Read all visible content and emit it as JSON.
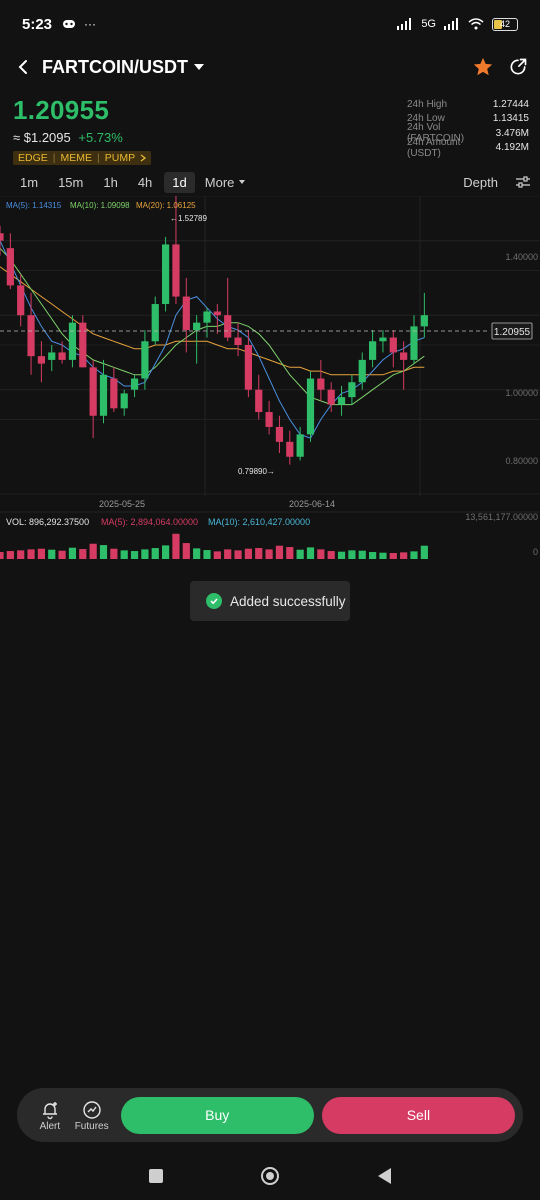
{
  "status_bar": {
    "time": "5:23",
    "network": "5G",
    "battery": "42"
  },
  "header": {
    "pair": "FARTCOIN/USDT"
  },
  "price": {
    "last": "1.20955",
    "fiat": "≈ $1.2095",
    "change": "+5.73%"
  },
  "tags": [
    "EDGE",
    "MEME",
    "PUMP"
  ],
  "stats": [
    {
      "label": "24h High",
      "value": "1.27444"
    },
    {
      "label": "24h Low",
      "value": "1.13415"
    },
    {
      "label": "24h Vol (FARTCOIN)",
      "value": "3.476M"
    },
    {
      "label": "24h Amount (USDT)",
      "value": "4.192M"
    }
  ],
  "intervals": {
    "items": [
      "1m",
      "15m",
      "1h",
      "4h",
      "1d"
    ],
    "active": "1d",
    "more": "More",
    "depth": "Depth"
  },
  "colors": {
    "up": "#2ebd68",
    "down": "#d63c63",
    "ma5": "#4a90e2",
    "ma10": "#7ed36b",
    "ma20": "#e8a43c"
  },
  "chart_data": {
    "type": "candlestick",
    "ma_legend": {
      "ma5": "MA(5): 1.14315",
      "ma10": "MA(10): 1.09098",
      "ma20": "MA(20): 1.06125"
    },
    "price_axis": [
      {
        "value": 1.4,
        "label": "1.40000"
      },
      {
        "value": 1.0,
        "label": "1.00000"
      },
      {
        "value": 0.8,
        "label": "0.80000"
      }
    ],
    "ylim": [
      0.72,
      1.52
    ],
    "current_price": {
      "value": 1.20955,
      "label": "1.20955"
    },
    "max_marker": {
      "value": 1.52789,
      "label": "←1.52789"
    },
    "min_marker": {
      "value": 0.7989,
      "label": "0.79890→"
    },
    "date_labels": [
      "2025-05-25",
      "2025-06-14"
    ],
    "candles": [
      {
        "o": 1.42,
        "h": 1.44,
        "l": 1.36,
        "c": 1.4
      },
      {
        "o": 1.38,
        "h": 1.42,
        "l": 1.27,
        "c": 1.28
      },
      {
        "o": 1.28,
        "h": 1.31,
        "l": 1.17,
        "c": 1.2
      },
      {
        "o": 1.2,
        "h": 1.26,
        "l": 1.04,
        "c": 1.09
      },
      {
        "o": 1.09,
        "h": 1.13,
        "l": 1.02,
        "c": 1.07
      },
      {
        "o": 1.08,
        "h": 1.12,
        "l": 1.05,
        "c": 1.1
      },
      {
        "o": 1.1,
        "h": 1.13,
        "l": 1.07,
        "c": 1.08
      },
      {
        "o": 1.08,
        "h": 1.2,
        "l": 1.06,
        "c": 1.18
      },
      {
        "o": 1.18,
        "h": 1.2,
        "l": 1.06,
        "c": 1.06
      },
      {
        "o": 1.06,
        "h": 1.08,
        "l": 0.87,
        "c": 0.93
      },
      {
        "o": 0.93,
        "h": 1.08,
        "l": 0.91,
        "c": 1.04
      },
      {
        "o": 1.03,
        "h": 1.06,
        "l": 0.94,
        "c": 0.95
      },
      {
        "o": 0.95,
        "h": 1.0,
        "l": 0.93,
        "c": 0.99
      },
      {
        "o": 1.0,
        "h": 1.04,
        "l": 0.98,
        "c": 1.03
      },
      {
        "o": 1.03,
        "h": 1.16,
        "l": 1.0,
        "c": 1.13
      },
      {
        "o": 1.13,
        "h": 1.25,
        "l": 1.12,
        "c": 1.23
      },
      {
        "o": 1.23,
        "h": 1.41,
        "l": 1.21,
        "c": 1.39
      },
      {
        "o": 1.39,
        "h": 1.52789,
        "l": 1.23,
        "c": 1.25
      },
      {
        "o": 1.25,
        "h": 1.3,
        "l": 1.1,
        "c": 1.16
      },
      {
        "o": 1.16,
        "h": 1.2,
        "l": 1.07,
        "c": 1.18
      },
      {
        "o": 1.18,
        "h": 1.22,
        "l": 1.14,
        "c": 1.21
      },
      {
        "o": 1.21,
        "h": 1.23,
        "l": 1.15,
        "c": 1.2
      },
      {
        "o": 1.2,
        "h": 1.3,
        "l": 1.13,
        "c": 1.14
      },
      {
        "o": 1.14,
        "h": 1.18,
        "l": 1.09,
        "c": 1.12
      },
      {
        "o": 1.12,
        "h": 1.16,
        "l": 0.98,
        "c": 1.0
      },
      {
        "o": 1.0,
        "h": 1.04,
        "l": 0.92,
        "c": 0.94
      },
      {
        "o": 0.94,
        "h": 0.97,
        "l": 0.88,
        "c": 0.9
      },
      {
        "o": 0.9,
        "h": 0.93,
        "l": 0.83,
        "c": 0.86
      },
      {
        "o": 0.86,
        "h": 0.89,
        "l": 0.7989,
        "c": 0.82
      },
      {
        "o": 0.82,
        "h": 0.9,
        "l": 0.81,
        "c": 0.88
      },
      {
        "o": 0.88,
        "h": 1.05,
        "l": 0.86,
        "c": 1.03
      },
      {
        "o": 1.03,
        "h": 1.08,
        "l": 0.97,
        "c": 1.0
      },
      {
        "o": 1.0,
        "h": 1.02,
        "l": 0.94,
        "c": 0.96
      },
      {
        "o": 0.96,
        "h": 1.01,
        "l": 0.93,
        "c": 0.98
      },
      {
        "o": 0.98,
        "h": 1.04,
        "l": 0.96,
        "c": 1.02
      },
      {
        "o": 1.02,
        "h": 1.1,
        "l": 1.0,
        "c": 1.08
      },
      {
        "o": 1.08,
        "h": 1.16,
        "l": 1.06,
        "c": 1.13
      },
      {
        "o": 1.13,
        "h": 1.16,
        "l": 1.1,
        "c": 1.14
      },
      {
        "o": 1.14,
        "h": 1.16,
        "l": 1.06,
        "c": 1.1
      },
      {
        "o": 1.1,
        "h": 1.13,
        "l": 1.0,
        "c": 1.08
      },
      {
        "o": 1.08,
        "h": 1.2,
        "l": 1.07,
        "c": 1.17
      },
      {
        "o": 1.17,
        "h": 1.26,
        "l": 1.14,
        "c": 1.2
      }
    ],
    "ma5": [
      1.4,
      1.34,
      1.28,
      1.22,
      1.17,
      1.13,
      1.12,
      1.1,
      1.09,
      1.06,
      1.04,
      1.03,
      1.01,
      1.01,
      1.02,
      1.07,
      1.12,
      1.2,
      1.24,
      1.25,
      1.22,
      1.19,
      1.17,
      1.16,
      1.14,
      1.09,
      1.03,
      0.97,
      0.92,
      0.88,
      0.87,
      0.92,
      0.96,
      0.99,
      1.0,
      1.02,
      1.05,
      1.08,
      1.1,
      1.11,
      1.13,
      1.14
    ],
    "ma10": [
      1.38,
      1.35,
      1.31,
      1.27,
      1.23,
      1.19,
      1.15,
      1.12,
      1.1,
      1.08,
      1.07,
      1.06,
      1.05,
      1.04,
      1.04,
      1.06,
      1.09,
      1.12,
      1.14,
      1.16,
      1.17,
      1.17,
      1.18,
      1.18,
      1.17,
      1.15,
      1.12,
      1.08,
      1.04,
      1.01,
      0.98,
      0.97,
      0.96,
      0.96,
      0.96,
      0.98,
      1.0,
      1.02,
      1.04,
      1.05,
      1.07,
      1.09
    ],
    "ma20": [
      1.33,
      1.31,
      1.29,
      1.27,
      1.25,
      1.23,
      1.21,
      1.19,
      1.17,
      1.15,
      1.14,
      1.13,
      1.12,
      1.11,
      1.11,
      1.12,
      1.12,
      1.13,
      1.13,
      1.13,
      1.13,
      1.12,
      1.11,
      1.11,
      1.1,
      1.09,
      1.08,
      1.07,
      1.06,
      1.06,
      1.05,
      1.05,
      1.04,
      1.04,
      1.04,
      1.04,
      1.04,
      1.04,
      1.05,
      1.05,
      1.06,
      1.06
    ],
    "volume": {
      "legend": {
        "vol": "VOL: 896,292.37500",
        "ma5": "MA(5): 2,894,064.00000",
        "ma10": "MA(10): 2,610,427.00000"
      },
      "axis_max": "13,561,177.00000",
      "axis_zero": "0",
      "ylim": [
        0,
        13561177
      ],
      "values": [
        2.1,
        2.4,
        2.6,
        2.9,
        3.1,
        2.8,
        2.5,
        3.4,
        3.0,
        4.6,
        4.2,
        3.1,
        2.6,
        2.4,
        2.9,
        3.3,
        4.1,
        7.6,
        4.8,
        3.2,
        2.7,
        2.3,
        2.9,
        2.6,
        3.1,
        3.3,
        2.9,
        4.0,
        3.6,
        2.8,
        3.5,
        2.9,
        2.4,
        2.2,
        2.6,
        2.5,
        2.1,
        1.9,
        1.8,
        2.0,
        2.3,
        4.0
      ]
    }
  },
  "toast": {
    "message": "Added successfully"
  },
  "bottom_bar": {
    "alert": "Alert",
    "futures": "Futures",
    "buy": "Buy",
    "sell": "Sell"
  }
}
